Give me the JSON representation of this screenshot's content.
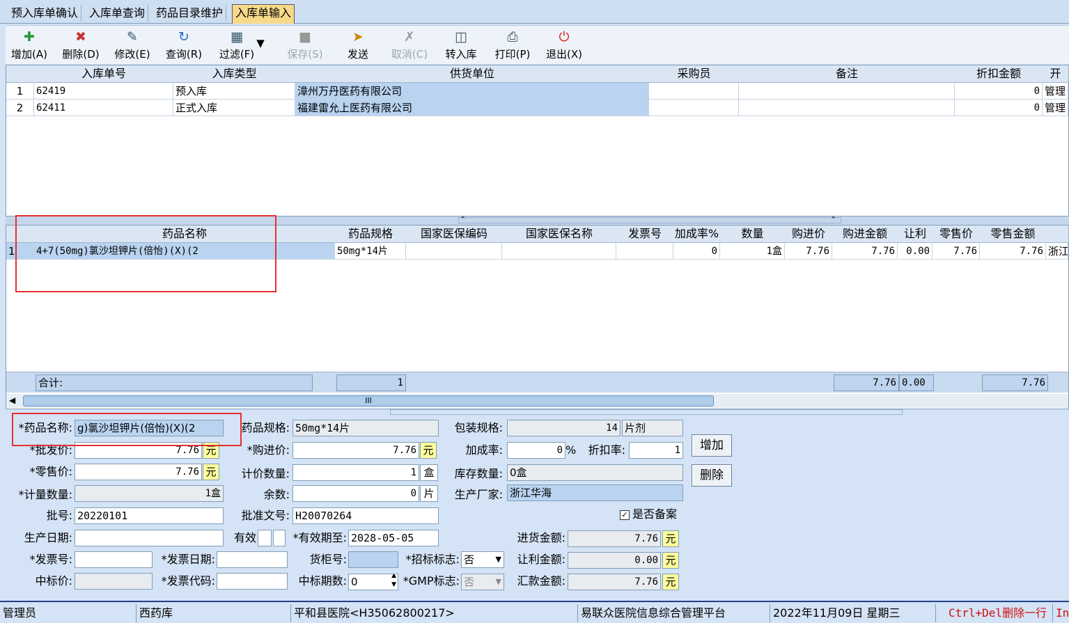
{
  "tabs": [
    "预入库单确认",
    "入库单查询",
    "药品目录维护",
    "入库单输入"
  ],
  "toolbar": [
    {
      "label": "增加(A)",
      "icon": "add-icon",
      "enabled": true
    },
    {
      "label": "删除(D)",
      "icon": "delete-icon",
      "enabled": true
    },
    {
      "label": "修改(E)",
      "icon": "edit-icon",
      "enabled": true
    },
    {
      "label": "查询(R)",
      "icon": "refresh-icon",
      "enabled": true
    },
    {
      "label": "过滤(F)",
      "icon": "filter-icon",
      "enabled": true
    },
    {
      "label": "保存(S)",
      "icon": "save-icon",
      "enabled": false
    },
    {
      "label": "发送",
      "icon": "send-icon",
      "enabled": true
    },
    {
      "label": "取消(C)",
      "icon": "cancel-icon",
      "enabled": false
    },
    {
      "label": "转入库",
      "icon": "transfer-icon",
      "enabled": true
    },
    {
      "label": "打印(P)",
      "icon": "print-icon",
      "enabled": true
    },
    {
      "label": "退出(X)",
      "icon": "exit-icon",
      "enabled": true
    }
  ],
  "upper_grid": {
    "headers": [
      "入库单号",
      "入库类型",
      "供货单位",
      "采购员",
      "备注",
      "折扣金额",
      "开"
    ],
    "rows": [
      {
        "idx": "1",
        "no": "62419",
        "type": "预入库",
        "supplier": "漳州万丹医药有限公司",
        "buyer": "",
        "note": "",
        "discount": "0",
        "extra": "管理"
      },
      {
        "idx": "2",
        "no": "62411",
        "type": "正式入库",
        "supplier": "福建雷允上医药有限公司",
        "buyer": "",
        "note": "",
        "discount": "0",
        "extra": "管理"
      }
    ]
  },
  "lower_grid": {
    "headers": [
      "药品名称",
      "药品规格",
      "国家医保编码",
      "国家医保名称",
      "发票号",
      "加成率%",
      "数量",
      "购进价",
      "购进金额",
      "让利",
      "零售价",
      "零售金额"
    ],
    "rows": [
      {
        "idx": "1",
        "name": "4+7(50mg)氯沙坦钾片(倍怡)(X)(2",
        "spec": "50mg*14片",
        "code": "",
        "ins_name": "",
        "invoice": "",
        "markup": "0",
        "qty": "1盒",
        "price": "7.76",
        "amount": "7.76",
        "rebate": "0.00",
        "retail": "7.76",
        "retail_amount": "7.76",
        "extra": "浙江"
      }
    ],
    "totals": {
      "label": "合计:",
      "qty": "1",
      "amount": "7.76",
      "rebate": "0.00",
      "retail_amount": "7.76"
    },
    "scroll_marker": "III"
  },
  "form": {
    "drug_name_label": "*药品名称:",
    "drug_name": "g)氯沙坦钾片(倍怡)(X)(2",
    "spec_label": "药品规格:",
    "spec": "50mg*14片",
    "pack_label": "包装规格:",
    "pack_qty": "14",
    "pack_unit": "片剂",
    "wholesale_label": "*批发价:",
    "wholesale": "7.76",
    "yuan": "元",
    "purchase_label": "*购进价:",
    "purchase": "7.76",
    "markup_label": "加成率:",
    "markup": "0",
    "percent": "%",
    "discount_rate_label": "折扣率:",
    "discount_rate": "1",
    "retail_label": "*零售价:",
    "retail": "7.76",
    "billing_qty_label": "计价数量:",
    "billing_qty": "1",
    "billing_unit": "盒",
    "stock_label": "库存数量:",
    "stock": "0盒",
    "measure_qty_label": "*计量数量:",
    "measure_qty": "1盒",
    "remainder_label": "余数:",
    "remainder": "0",
    "remainder_unit": "片",
    "manufacturer_label": "生产厂家:",
    "manufacturer": "浙江华海",
    "batch_label": "批号:",
    "batch": "20220101",
    "approval_label": "批准文号:",
    "approval": "H20070264",
    "filed_label": "是否备案",
    "filed_checked": true,
    "prod_date_label": "生产日期:",
    "prod_date": "",
    "valid_label": "有效",
    "expiry_label": "*有效期至:",
    "expiry": "2028-05-05",
    "purchase_amount_label": "进货金额:",
    "purchase_amount": "7.76",
    "invoice_no_label": "*发票号:",
    "invoice_no": "",
    "invoice_date_label": "*发票日期:",
    "invoice_date": "",
    "shelf_label": "货柜号:",
    "shelf": "",
    "bid_flag_label": "*招标标志:",
    "bid_flag": "否",
    "rebate_amount_label": "让利金额:",
    "rebate_amount": "0.00",
    "bid_price_label": "中标价:",
    "bid_price": "",
    "invoice_code_label": "*发票代码:",
    "invoice_code": "",
    "bid_period_label": "中标期数:",
    "bid_period": "0",
    "gmp_label": "*GMP标志:",
    "gmp": "否",
    "remit_label": "汇款金额:",
    "remit": "7.76",
    "add_button": "增加",
    "delete_button": "删除"
  },
  "status": {
    "user": "管理员",
    "warehouse": "西药库",
    "hospital": "平和县医院<H35062800217>",
    "platform": "易联众医院信息综合管理平台",
    "date": "2022年11月09日 星期三",
    "hint": "Ctrl+Del删除一行",
    "extra": "In"
  },
  "colors": {
    "highlight_box": "#e53030",
    "active_tab": "#f7d98a",
    "selected_row": "#b9d3f0",
    "unit_box": "#ffff9c",
    "status_border": "#1f3f8f",
    "exit_icon": "#e02020",
    "hint_text": "#d01010"
  }
}
